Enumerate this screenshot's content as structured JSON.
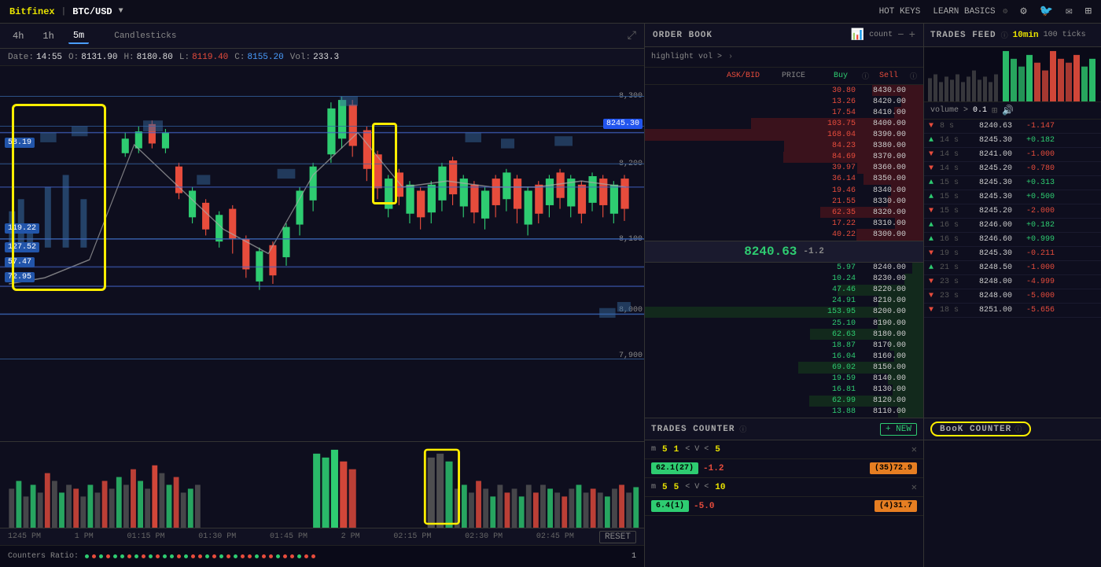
{
  "nav": {
    "brand": "Bitfinex",
    "pair": "BTC/USD",
    "hotkeys": "HOT KEYS",
    "learn_basics": "LEARN BASICS"
  },
  "chart": {
    "timeframes": [
      "4h",
      "1h",
      "5m"
    ],
    "active_timeframe": "5m",
    "chart_type": "Candlesticks",
    "ohlc": {
      "date": "Date: 14:55",
      "open_label": "O:",
      "open": "8131.90",
      "high_label": "H:",
      "high": "8180.80",
      "low_label": "L:",
      "low": "8119.40",
      "close_label": "C:",
      "close": "8155.20",
      "vol_label": "Vol:",
      "vol": "233.3"
    },
    "price_levels": [
      {
        "value": "58.19",
        "top": "19%"
      },
      {
        "value": "119.22",
        "top": "42%"
      },
      {
        "value": "127.52",
        "top": "48%"
      },
      {
        "value": "57.47",
        "top": "52%"
      },
      {
        "value": "72.95",
        "top": "56%"
      }
    ],
    "price_axis": [
      {
        "price": "8300",
        "pct": "8%"
      },
      {
        "price": "8245.30",
        "pct": "16%",
        "highlight": true
      },
      {
        "price": "8200",
        "pct": "26%"
      },
      {
        "price": "8100",
        "pct": "46%"
      },
      {
        "price": "8000",
        "pct": "66%"
      },
      {
        "price": "7900",
        "pct": "78%"
      }
    ],
    "time_labels": [
      "1245 PM",
      "1 PM",
      "01:15 PM",
      "01:30 PM",
      "01:45 PM",
      "2 PM",
      "02:15 PM",
      "02:30 PM",
      "02:45 PM"
    ],
    "reset_label": "RESET",
    "counters_ratio_label": "Counters Ratio:",
    "cr_number": "1"
  },
  "order_book": {
    "title": "ORDER BOOK",
    "highlight_label": "highlight vol >",
    "count_label": "count",
    "col_ask": "ASK/BID",
    "col_price": "PRICE",
    "col_buy": "Buy",
    "col_sell": "Sell",
    "asks": [
      {
        "qty": "30.80",
        "price": "8430.00"
      },
      {
        "qty": "13.26",
        "price": "8420.00"
      },
      {
        "qty": "17.54",
        "price": "8410.00"
      },
      {
        "qty": "103.75",
        "price": "8400.00"
      },
      {
        "qty": "168.04",
        "price": "8390.00"
      },
      {
        "qty": "84.23",
        "price": "8380.00"
      },
      {
        "qty": "84.69",
        "price": "8370.00"
      },
      {
        "qty": "39.97",
        "price": "8360.00"
      },
      {
        "qty": "36.14",
        "price": "8350.00"
      },
      {
        "qty": "19.46",
        "price": "8340.00"
      },
      {
        "qty": "21.55",
        "price": "8330.00"
      },
      {
        "qty": "62.35",
        "price": "8320.00"
      },
      {
        "qty": "17.22",
        "price": "8310.00"
      },
      {
        "qty": "40.22",
        "price": "8300.00"
      }
    ],
    "current_price": "8240.63",
    "current_change": "-1.2",
    "bids": [
      {
        "qty": "5.97",
        "price": "8240.00"
      },
      {
        "qty": "10.24",
        "price": "8230.00"
      },
      {
        "qty": "47.46",
        "price": "8220.00"
      },
      {
        "qty": "24.91",
        "price": "8210.00"
      },
      {
        "qty": "153.95",
        "price": "8200.00"
      },
      {
        "qty": "25.10",
        "price": "8190.00"
      },
      {
        "qty": "62.63",
        "price": "8180.00"
      },
      {
        "qty": "18.87",
        "price": "8170.00"
      },
      {
        "qty": "16.04",
        "price": "8160.00"
      },
      {
        "qty": "69.02",
        "price": "8150.00"
      },
      {
        "qty": "19.59",
        "price": "8140.00"
      },
      {
        "qty": "16.81",
        "price": "8130.00"
      },
      {
        "qty": "62.99",
        "price": "8120.00"
      },
      {
        "qty": "13.88",
        "price": "8110.00"
      }
    ]
  },
  "trades_feed": {
    "title": "TRADES FEED",
    "time_btn": "10min",
    "ticks_btn": "100 ticks",
    "vol_label": "volume >",
    "vol_val": "0.1",
    "rows": [
      {
        "dir": "down",
        "time": "8 s",
        "price": "8240.63",
        "change": "-1.147"
      },
      {
        "dir": "up",
        "time": "14 s",
        "price": "8245.30",
        "change": "+0.182"
      },
      {
        "dir": "down",
        "time": "14 s",
        "price": "8241.00",
        "change": "-1.000"
      },
      {
        "dir": "down",
        "time": "14 s",
        "price": "8245.20",
        "change": "-0.780"
      },
      {
        "dir": "up",
        "time": "15 s",
        "price": "8245.30",
        "change": "+0.313"
      },
      {
        "dir": "up",
        "time": "15 s",
        "price": "8245.30",
        "change": "+0.500"
      },
      {
        "dir": "down",
        "time": "15 s",
        "price": "8245.20",
        "change": "-2.000"
      },
      {
        "dir": "up",
        "time": "16 s",
        "price": "8246.00",
        "change": "+0.182"
      },
      {
        "dir": "up",
        "time": "16 s",
        "price": "8246.60",
        "change": "+0.999"
      },
      {
        "dir": "down",
        "time": "19 s",
        "price": "8245.30",
        "change": "-0.211"
      },
      {
        "dir": "up",
        "time": "21 s",
        "price": "8248.50",
        "change": "-1.000"
      },
      {
        "dir": "down",
        "time": "23 s",
        "price": "8248.00",
        "change": "-4.999"
      },
      {
        "dir": "down",
        "time": "23 s",
        "price": "8248.00",
        "change": "-5.000"
      },
      {
        "dir": "down",
        "time": "18 s",
        "price": "8251.00",
        "change": "-5.656"
      }
    ]
  },
  "trades_counter": {
    "title": "TRADES COUNTER",
    "new_label": "+ NEW",
    "row1": {
      "m_label": "m",
      "m_val": "5",
      "val2": "1",
      "v_label": "< V <",
      "v_val": "5",
      "close": "✕"
    },
    "row1_data": {
      "green_val": "62.1(27)",
      "red_val": "-1.2",
      "orange_val": "(35)72.9"
    },
    "row2": {
      "m_label": "m",
      "m_val": "5",
      "val2": "5",
      "v_label": "< V <",
      "v_val": "10",
      "close": "✕"
    },
    "row2_data": {
      "green_val": "6.4(1)",
      "red_val": "-5.0",
      "orange_val": "(4)31.7"
    }
  },
  "book_counter": {
    "title": "BooK COUNTER"
  }
}
